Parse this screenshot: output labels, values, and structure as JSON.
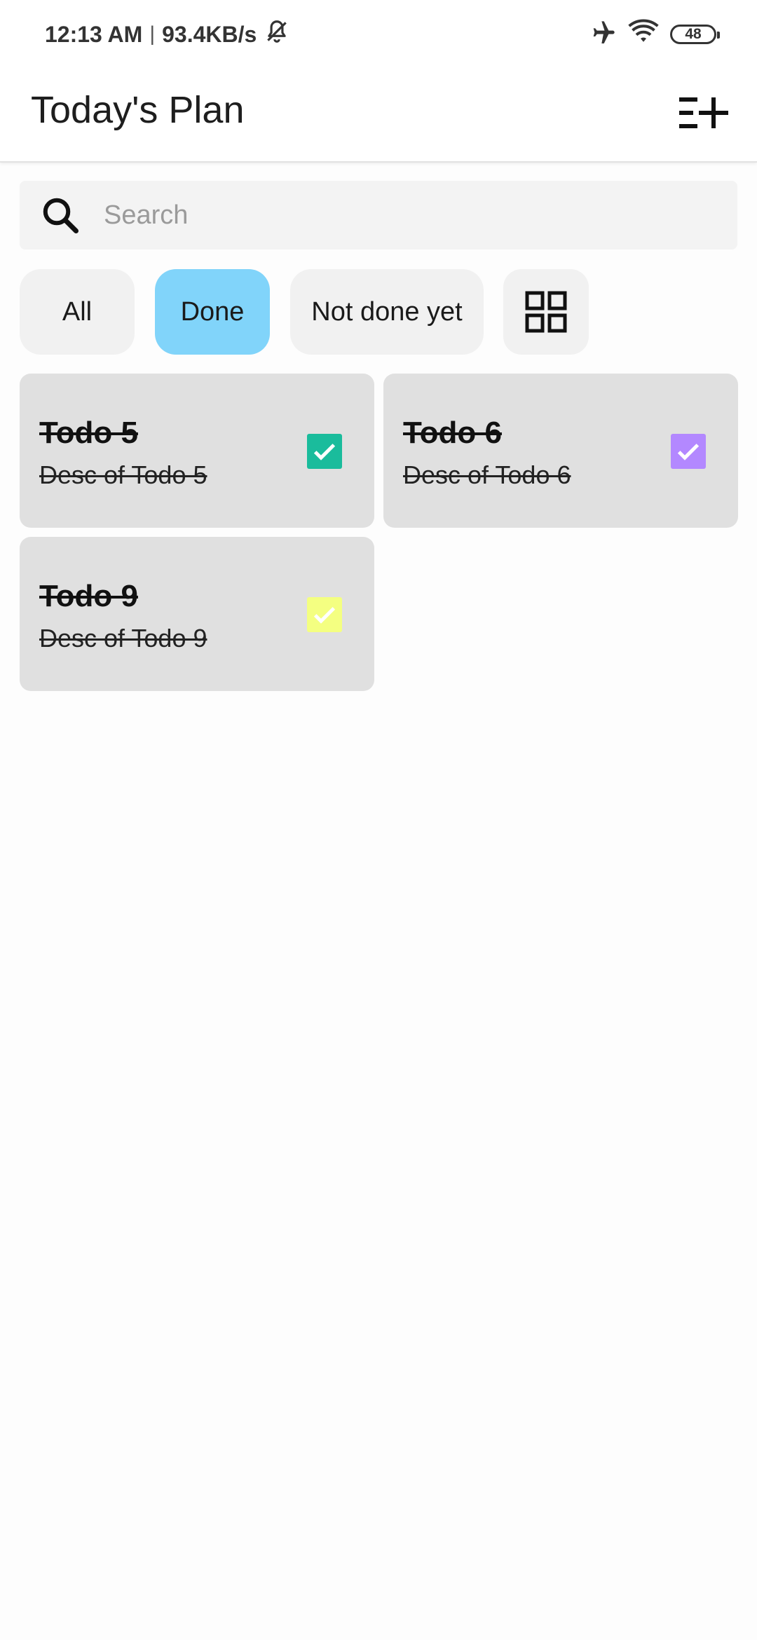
{
  "status_bar": {
    "time": "12:13 AM",
    "separator": "|",
    "speed": "93.4KB/s",
    "battery": "48",
    "icons": [
      "bell-off-icon",
      "airplane-icon",
      "wifi-icon",
      "battery-icon"
    ]
  },
  "app_bar": {
    "title": "Today's Plan",
    "action_icon": "playlist-add-icon"
  },
  "search": {
    "placeholder": "Search",
    "value": "",
    "icon": "search-icon"
  },
  "filters": {
    "items": [
      {
        "label": "All",
        "active": false
      },
      {
        "label": "Done",
        "active": true
      },
      {
        "label": "Not done yet",
        "active": false
      }
    ],
    "view_toggle_icon": "grid-view-icon",
    "active_color": "#81d4fa"
  },
  "todos": [
    {
      "title": "Todo 5",
      "desc": "Desc of Todo 5",
      "done": true,
      "color": "#1abc9c"
    },
    {
      "title": "Todo 6",
      "desc": "Desc of Todo 6",
      "done": true,
      "color": "#b388ff"
    },
    {
      "title": "Todo 9",
      "desc": "Desc of Todo 9",
      "done": true,
      "color": "#f4ff81"
    }
  ],
  "colors": {
    "card_background": "#e0e0e0",
    "chip_background": "#f1f1f1",
    "search_background": "#f3f3f3"
  }
}
